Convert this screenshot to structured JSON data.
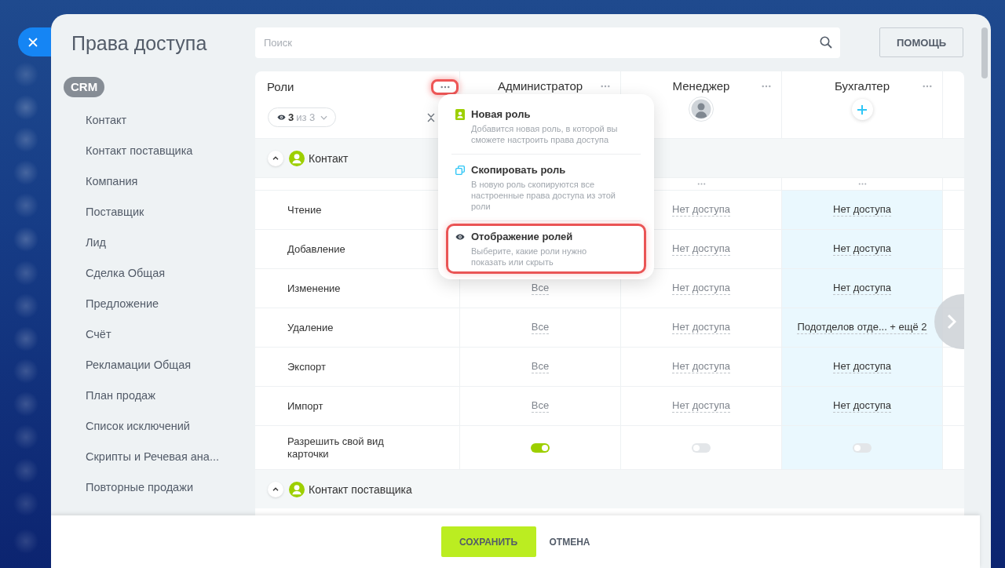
{
  "title": "Права доступа",
  "search": {
    "placeholder": "Поиск"
  },
  "help_button": "ПОМОЩЬ",
  "sidebar": {
    "badge": "CRM",
    "items": [
      "Контакт",
      "Контакт поставщика",
      "Компания",
      "Поставщик",
      "Лид",
      "Сделка Общая",
      "Предложение",
      "Счёт",
      "Рекламации Общая",
      "План продаж",
      "Список исключений",
      "Скрипты и Речевая ана...",
      "Повторные продажи"
    ]
  },
  "table": {
    "roles_header": {
      "label": "Роли",
      "menu_button": {
        "highlighted": true
      },
      "visibility_filter": {
        "count": "3",
        "of": "из 3"
      }
    },
    "columns": [
      {
        "name": "Администратор",
        "kind": "plain",
        "selected": false
      },
      {
        "name": "Менеджер",
        "kind": "avatar",
        "selected": false
      },
      {
        "name": "Бухгалтер",
        "kind": "add",
        "selected": true
      }
    ],
    "sections": [
      {
        "title": "Контакт",
        "expanded": true,
        "rows": [
          {
            "kind": "actions",
            "cells": [
              null,
              {
                "kind": "more"
              },
              {
                "kind": "more"
              }
            ]
          },
          {
            "kind": "select",
            "label": "Чтение",
            "cells": [
              null,
              "Нет доступа",
              "Нет доступа"
            ]
          },
          {
            "kind": "select",
            "label": "Добавление",
            "cells": [
              null,
              "Нет доступа",
              "Нет доступа"
            ]
          },
          {
            "kind": "select",
            "label": "Изменение",
            "cells": [
              "Все",
              "Нет доступа",
              "Нет доступа"
            ]
          },
          {
            "kind": "select",
            "label": "Удаление",
            "cells": [
              "Все",
              "Нет доступа",
              "Подотделов отде... + ещё 2"
            ]
          },
          {
            "kind": "select",
            "label": "Экспорт",
            "cells": [
              "Все",
              "Нет доступа",
              "Нет доступа"
            ]
          },
          {
            "kind": "select",
            "label": "Импорт",
            "cells": [
              "Все",
              "Нет доступа",
              "Нет доступа"
            ]
          },
          {
            "kind": "toggle",
            "label": "Разрешить свой вид карточки",
            "cells": [
              {
                "on": true
              },
              {
                "on": false
              },
              {
                "on": false
              }
            ]
          }
        ]
      },
      {
        "title": "Контакт поставщика",
        "expanded": true
      }
    ],
    "role_menu": {
      "items": [
        {
          "kind": "new",
          "title": "Новая роль",
          "description": "Добавится новая роль, в которой вы сможете настроить права доступа",
          "highlighted": false
        },
        {
          "kind": "copy",
          "title": "Скопировать роль",
          "description": "В новую роль скопируются все настроенные права доступа из этой роли",
          "highlighted": false
        },
        {
          "kind": "display",
          "title": "Отображение ролей",
          "description": "Выберите, какие роли нужно показать или скрыть",
          "highlighted": true
        }
      ]
    }
  },
  "footer": {
    "save": "СОХРАНИТЬ",
    "cancel": "ОТМЕНА"
  }
}
